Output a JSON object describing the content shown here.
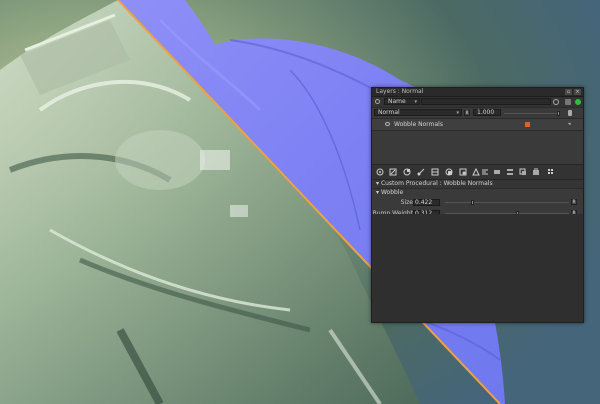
{
  "panel": {
    "title": "Layers : Normal",
    "filter": {
      "mode_value": "Name"
    },
    "blend": {
      "mode_value": "Normal",
      "opacity_value": "1.000"
    },
    "layer": {
      "name": "Wobble Normals",
      "control_glyph": "◂"
    },
    "section_title": "Custom Procedural : Wobble Normals",
    "group_title": "Wobble",
    "params": [
      {
        "label": "Size",
        "value": "0.422",
        "level": 0.22
      },
      {
        "label": "Bump Weight",
        "value": "0.312",
        "level": 0.58
      }
    ],
    "window_controls": [
      "▫",
      "×"
    ],
    "toggle_glyphs": {
      "collapse": "▾",
      "reset": "R",
      "param_reset": "R"
    }
  },
  "icons": {
    "search": "search-icon",
    "eye": "eye-icon",
    "fx": "effect-icon",
    "toolbar": [
      "add-layer-icon",
      "add-paint-layer-icon",
      "add-adjust-layer-icon",
      "add-procedural-icon",
      "add-mask-icon",
      "add-channel-icon",
      "add-filter-icon",
      "add-shader-icon",
      "add-group-icon",
      "merge-icon",
      "flatten-icon",
      "duplicate-icon",
      "delete-icon",
      "grid-icon"
    ]
  },
  "colors": {
    "accent": "#e0621c",
    "status_green": "#2fbf3a",
    "divider_orange": "#f0a23c",
    "normal_map_blue": "#7b80f2",
    "viewport_green": "#6f8f76"
  }
}
